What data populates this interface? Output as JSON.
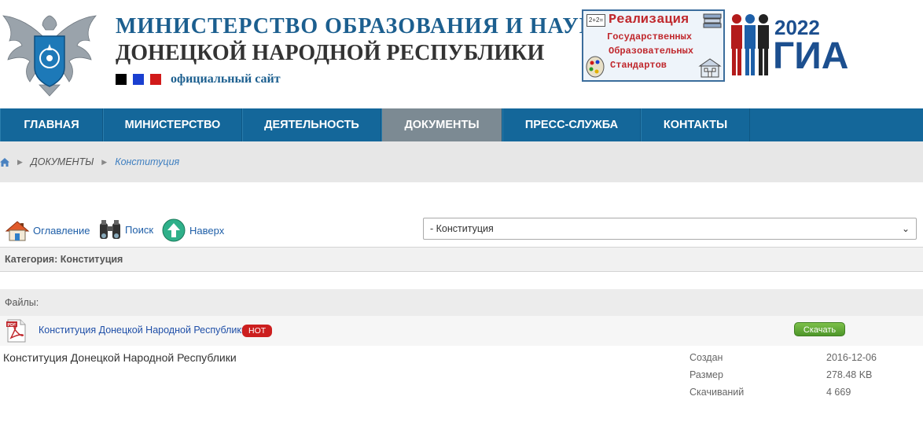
{
  "header": {
    "title_line1": "МИНИСТЕРСТВО ОБРАЗОВАНИЯ И НАУКИ",
    "title_line2": "ДОНЕЦКОЙ НАРОДНОЙ РЕСПУБЛИКИ",
    "subtitle": "официальный сайт",
    "flag_colors": [
      "#000000",
      "#1a3fd0",
      "#d11a1a"
    ],
    "banner_standards": {
      "line1": "Реализация",
      "line2": "Государственных",
      "line3": "Образовательных",
      "line4": "Стандартов",
      "badge": "2+2="
    },
    "banner_gia": {
      "year": "2022",
      "text": "ГИА"
    }
  },
  "nav": {
    "items": [
      {
        "label": "ГЛАВНАЯ"
      },
      {
        "label": "МИНИСТЕРСТВО"
      },
      {
        "label": "ДЕЯТЕЛЬНОСТЬ"
      },
      {
        "label": "ДОКУМЕНТЫ",
        "active": true
      },
      {
        "label": "ПРЕСС-СЛУЖБА"
      },
      {
        "label": "КОНТАКТЫ"
      }
    ]
  },
  "breadcrumb": {
    "home_icon": "home-icon",
    "items": [
      "ДОКУМЕНТЫ",
      "Конституция"
    ]
  },
  "toolbar": {
    "toc_label": "Оглавление",
    "search_label": "Поиск",
    "top_label": "Наверх",
    "category_select_value": "- Конституция"
  },
  "category": {
    "label": "Категория: Конституция"
  },
  "files": {
    "header": "Файлы:",
    "file_name": "Конституция Донецкой Народной Республики",
    "badge": "HOT",
    "download_label": "Скачать",
    "pdf_icon_text": "PDF",
    "description": "Конституция Донецкой Народной Республики",
    "meta": {
      "created_label": "Создан",
      "created_value": "2016-12-06",
      "size_label": "Размер",
      "size_value": "278.48 KB",
      "downloads_label": "Скачиваний",
      "downloads_value": "4 669"
    }
  }
}
